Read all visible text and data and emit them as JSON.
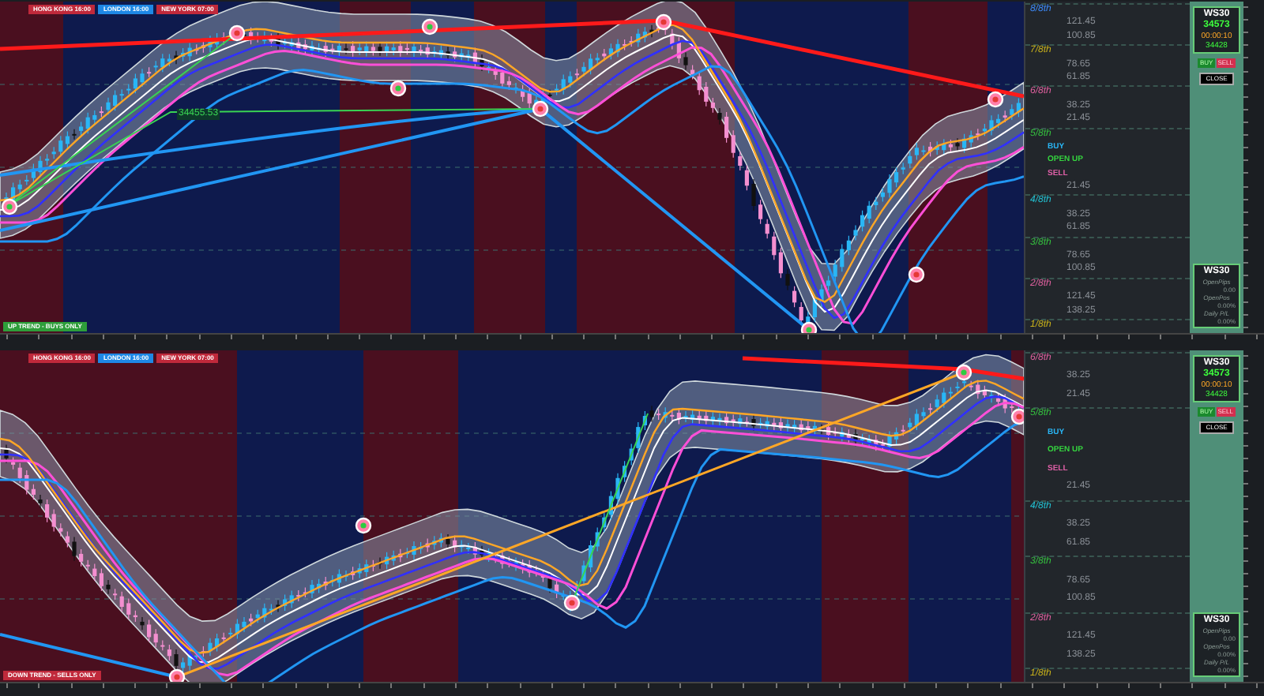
{
  "panes": [
    {
      "sessions": [
        {
          "text": "HONG KONG 16:00",
          "color": "#c0293b"
        },
        {
          "text": "LONDON 16:00",
          "color": "#1e88e5"
        },
        {
          "text": "NEW YORK 07:00",
          "color": "#c0293b"
        }
      ],
      "kind": "top",
      "price_tag": "34455.53",
      "trend": {
        "text": "UP TREND - BUYS ONLY",
        "kind": "up"
      },
      "scale": [
        {
          "kind": "level",
          "text": "8/8th",
          "color": "#3d8bfd"
        },
        {
          "kind": "value",
          "text": "121.45"
        },
        {
          "kind": "value",
          "text": "100.85"
        },
        {
          "kind": "level",
          "text": "7/8th",
          "color": "#c9b21a"
        },
        {
          "kind": "value",
          "text": "78.65"
        },
        {
          "kind": "value",
          "text": "61.85"
        },
        {
          "kind": "level",
          "text": "6/8th",
          "color": "#e0609f"
        },
        {
          "kind": "value",
          "text": "38.25"
        },
        {
          "kind": "value",
          "text": "21.45"
        },
        {
          "kind": "level",
          "text": "5/8th",
          "color": "#35c23f"
        },
        {
          "kind": "signal",
          "text": "BUY",
          "color": "#29b6f6"
        },
        {
          "kind": "signal",
          "text": "OPEN UP",
          "color": "#35d43f"
        },
        {
          "kind": "signal",
          "text": "SELL",
          "color": "#e060a8"
        },
        {
          "kind": "value",
          "text": "21.45"
        },
        {
          "kind": "level",
          "text": "4/8th",
          "color": "#22c3d4"
        },
        {
          "kind": "value",
          "text": "38.25"
        },
        {
          "kind": "value",
          "text": "61.85"
        },
        {
          "kind": "level",
          "text": "3/8th",
          "color": "#35c23f"
        },
        {
          "kind": "value",
          "text": "78.65"
        },
        {
          "kind": "value",
          "text": "100.85"
        },
        {
          "kind": "level",
          "text": "2/8th",
          "color": "#e0609f"
        },
        {
          "kind": "value",
          "text": "121.45"
        },
        {
          "kind": "value",
          "text": "138.25"
        },
        {
          "kind": "level",
          "text": "1/8th",
          "color": "#c9b21a"
        }
      ],
      "panel": {
        "symbol": "WS30",
        "price": "34573",
        "timer": "00:00:10",
        "price_2": "34428",
        "buttons": [
          {
            "label": "BUY",
            "kind": "buy"
          },
          {
            "label": "SELL",
            "kind": "sell"
          },
          {
            "label": "CLOSE",
            "kind": "close"
          }
        ],
        "stats_symbol": "WS30",
        "stats": [
          {
            "label": "OpenPips",
            "value": "0.00"
          },
          {
            "label": "OpenPos",
            "value": "0.00%"
          },
          {
            "label": "Daily P/L",
            "value": "0.00%"
          }
        ]
      }
    },
    {
      "sessions": [
        {
          "text": "HONG KONG 16:00",
          "color": "#c0293b"
        },
        {
          "text": "LONDON 16:00",
          "color": "#1e88e5"
        },
        {
          "text": "NEW YORK 07:00",
          "color": "#c0293b"
        }
      ],
      "kind": "bottom",
      "trend": {
        "text": "DOWN TREND - SELLS ONLY",
        "kind": "down"
      },
      "scale": [
        {
          "kind": "level",
          "text": "6/8th",
          "color": "#e0609f"
        },
        {
          "kind": "value",
          "text": "38.25"
        },
        {
          "kind": "value",
          "text": "21.45"
        },
        {
          "kind": "level",
          "text": "5/8th",
          "color": "#35c23f"
        },
        {
          "kind": "signal",
          "text": "BUY",
          "color": "#29b6f6"
        },
        {
          "kind": "signal",
          "text": "OPEN UP",
          "color": "#35d43f"
        },
        {
          "kind": "signal",
          "text": "SELL",
          "color": "#e060a8"
        },
        {
          "kind": "value",
          "text": "21.45"
        },
        {
          "kind": "level",
          "text": "4/8th",
          "color": "#22c3d4"
        },
        {
          "kind": "value",
          "text": "38.25"
        },
        {
          "kind": "value",
          "text": "61.85"
        },
        {
          "kind": "level",
          "text": "3/8th",
          "color": "#35c23f"
        },
        {
          "kind": "value",
          "text": "78.65"
        },
        {
          "kind": "value",
          "text": "100.85"
        },
        {
          "kind": "level",
          "text": "2/8th",
          "color": "#e0609f"
        },
        {
          "kind": "value",
          "text": "121.45"
        },
        {
          "kind": "value",
          "text": "138.25"
        },
        {
          "kind": "level",
          "text": "1/8th",
          "color": "#c9b21a"
        }
      ],
      "panel": {
        "symbol": "WS30",
        "price": "34573",
        "timer": "00:00:10",
        "price_2": "34428",
        "buttons": [
          {
            "label": "BUY",
            "kind": "buy"
          },
          {
            "label": "SELL",
            "kind": "sell"
          },
          {
            "label": "CLOSE",
            "kind": "close"
          }
        ],
        "stats_symbol": "WS30",
        "stats": [
          {
            "label": "OpenPips",
            "value": "0.00"
          },
          {
            "label": "OpenPos",
            "value": "0.00%"
          },
          {
            "label": "Daily P/L",
            "value": "0.00%"
          }
        ]
      }
    }
  ]
}
